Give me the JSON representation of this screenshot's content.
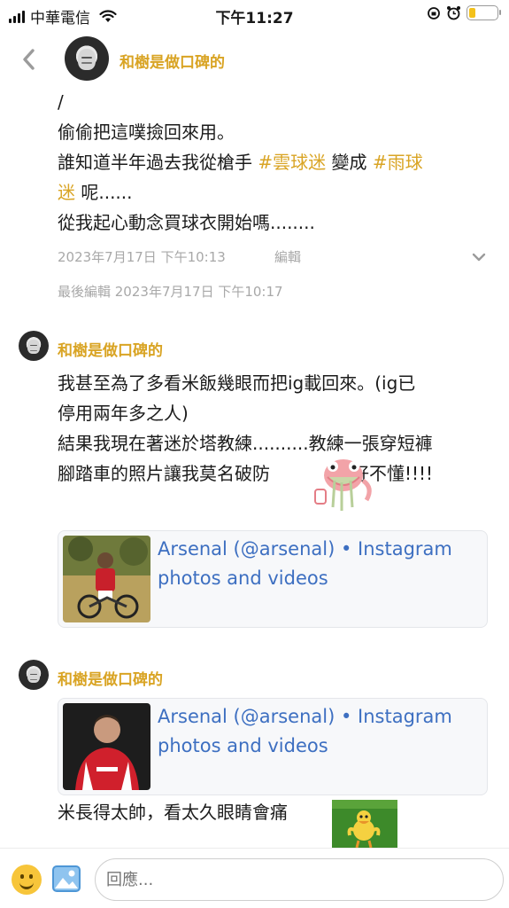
{
  "status_bar": {
    "carrier": "中華電信",
    "time": "下午11:27"
  },
  "header": {
    "author": "和樹是做口碑的"
  },
  "post": {
    "lines": [
      "/",
      "偷偷把這噗撿回來用。",
      "誰知道半年過去我從槍手 ",
      "#雲球迷",
      " 變成 ",
      "#雨球",
      "迷",
      " 呢......",
      "從我起心動念買球衣開始嗎........"
    ],
    "date": "2023年7月17日 下午10:13",
    "edit_label": "編輯",
    "last_edited": "最後編輯 2023年7月17日 下午10:17"
  },
  "comments": [
    {
      "author": "和樹是做口碑的",
      "lines": [
        "我甚至為了多看米飯幾眼而把ig載回來。(ig已",
        "停用兩年多之人)",
        "結果我現在著迷於塔教練..........教練一張穿短褲",
        "腳踏車的照片讓我莫名破防",
        "好不懂!!!!"
      ],
      "link_title": "Arsenal (@arsenal) • Instagram photos and videos"
    },
    {
      "author": "和樹是做口碑的",
      "link_title": "Arsenal (@arsenal) • Instagram photos and videos",
      "text": "米長得太帥，看太久眼睛會痛"
    }
  ],
  "reply": {
    "placeholder": "回應..."
  },
  "colors": {
    "accent": "#d9a424",
    "link": "#3d6fc1",
    "meta": "#a8a8a8"
  }
}
